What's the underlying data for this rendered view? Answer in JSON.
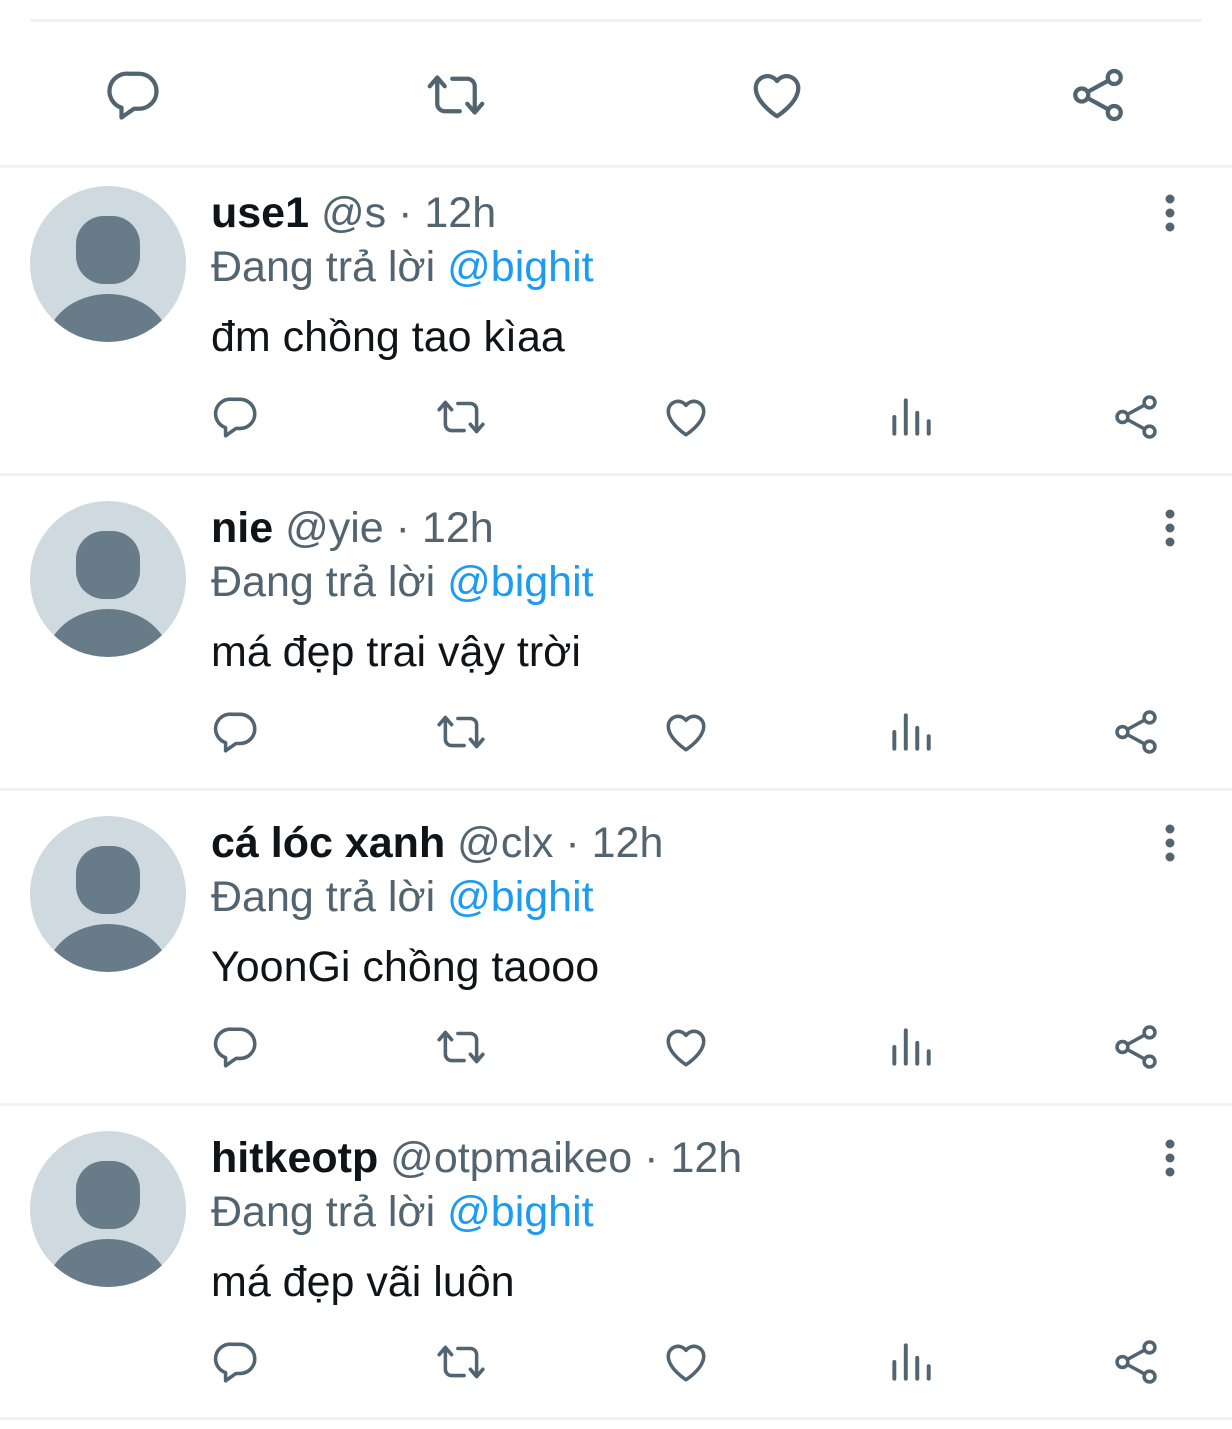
{
  "colors": {
    "text_primary": "#0f1419",
    "text_secondary": "#536471",
    "link": "#1d9bf0",
    "icon": "#536471",
    "avatar_bg": "#ced9e0",
    "avatar_fg": "#687b89",
    "divider": "#eff3f4"
  },
  "main_actions": {
    "icons": [
      "reply-icon",
      "retweet-icon",
      "like-icon",
      "share-icon"
    ]
  },
  "replies": [
    {
      "name": "use1",
      "handle": "@s",
      "dot": "·",
      "time": "12h",
      "replying_prefix": "Đang trả lời",
      "replying_to": "@bighit",
      "text": "đm chồng tao kìaa"
    },
    {
      "name": "nie",
      "handle": "@yie",
      "dot": "·",
      "time": "12h",
      "replying_prefix": "Đang trả lời",
      "replying_to": "@bighit",
      "text": "má đẹp trai vậy trời"
    },
    {
      "name": "cá lóc xanh",
      "handle": "@clx",
      "dot": "·",
      "time": "12h",
      "replying_prefix": "Đang trả lời",
      "replying_to": "@bighit",
      "text": "YoonGi chồng taooo"
    },
    {
      "name": "hitkeotp",
      "handle": "@otpmaikeo",
      "dot": "·",
      "time": "12h",
      "replying_prefix": "Đang trả lời",
      "replying_to": "@bighit",
      "text": "má đẹp vãi luôn"
    }
  ]
}
